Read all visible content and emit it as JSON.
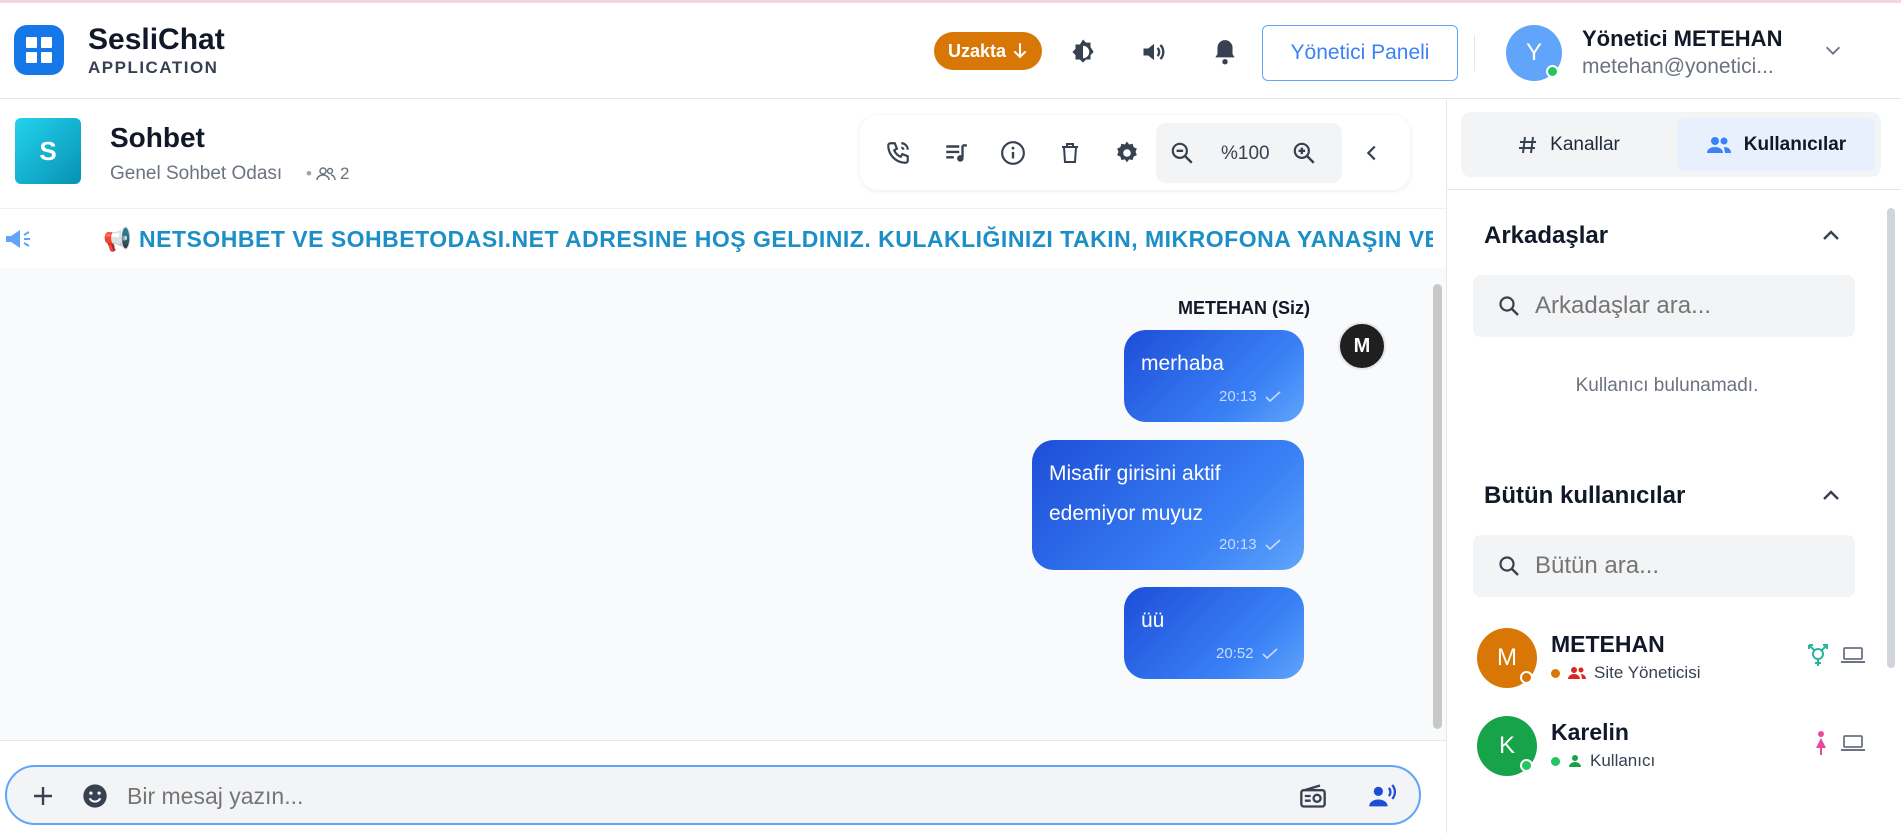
{
  "app": {
    "title": "SesliChat",
    "subtitle": "APPLICATION"
  },
  "header": {
    "status_label": "Uzakta",
    "admin_panel_label": "Yönetici Paneli",
    "user": {
      "initial": "Y",
      "name": "Yönetici METEHAN",
      "email": "metehan@yonetici..."
    }
  },
  "room": {
    "initial": "S",
    "title": "Sohbet",
    "subtitle": "Genel Sohbet Odası",
    "member_count": "2",
    "zoom_label": "%100"
  },
  "announcement": {
    "text": "📢 NETSOHBET VE SOHBETODASI.NET ADRESINE HOŞ GELDINIZ. KULAKLIĞINIZI TAKIN, MIKROFONA YANAŞIN VE KE"
  },
  "messages": {
    "sender": "METEHAN (Siz)",
    "sender_initial": "M",
    "items": [
      {
        "text": "merhaba",
        "time": "20:13"
      },
      {
        "text": "Misafir girisini aktif edemiyor muyuz",
        "time": "20:13"
      },
      {
        "text": "üü",
        "time": "20:52"
      }
    ]
  },
  "composer": {
    "placeholder": "Bir mesaj yazın..."
  },
  "panel": {
    "tabs": [
      {
        "label": "Kanallar"
      },
      {
        "label": "Kullanıcılar"
      }
    ],
    "friends": {
      "title": "Arkadaşlar",
      "search_placeholder": "Arkadaşlar ara...",
      "empty": "Kullanıcı bulunamadı."
    },
    "all_users": {
      "title": "Bütün kullanıcılar",
      "search_placeholder": "Bütün ara...",
      "users": [
        {
          "initial": "M",
          "name": "METEHAN",
          "role": "Site Yöneticisi",
          "avatar_color": "#d97706",
          "status_color": "#d97706",
          "role_color": "#dc2626",
          "gender_icon": "transgender-icon"
        },
        {
          "initial": "K",
          "name": "Karelin",
          "role": "Kullanıcı",
          "avatar_color": "#16a34a",
          "status_color": "#22c55e",
          "role_color": "#16a34a",
          "gender_icon": "female-icon"
        }
      ]
    }
  }
}
